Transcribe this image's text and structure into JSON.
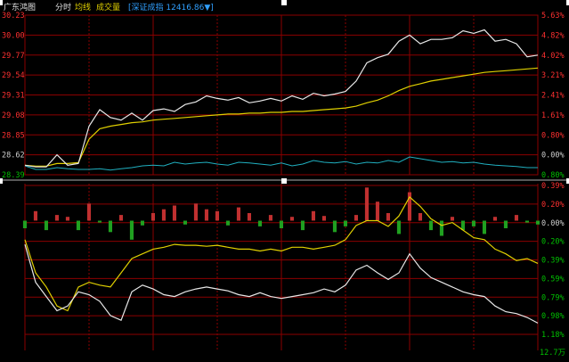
{
  "header": {
    "title": "广东鸿图",
    "tab_intraday": "分时",
    "avg_label": "均线",
    "volume_label": "成交量",
    "index_text": "[深证成指 12416.86▼]"
  },
  "colors": {
    "background": "#000000",
    "grid": "#8b0000",
    "up": "#ff3030",
    "down": "#00c000",
    "flat": "#d0d0d0",
    "price_line": "#e8e8e8",
    "avg_line": "#e0d000",
    "volume_line": "#20b0c0",
    "index_text": "#30a0ff",
    "volume_bar_up": "#c03030",
    "volume_bar_down": "#20a020"
  },
  "chart_data": [
    {
      "type": "line",
      "title": "",
      "y_left_ticks": [
        "30.23",
        "30.00",
        "29.77",
        "29.54",
        "29.31",
        "29.08",
        "28.85",
        "28.62",
        "28.39"
      ],
      "y_right_ticks": [
        "5.63%",
        "4.82%",
        "4.02%",
        "3.21%",
        "2.41%",
        "1.61%",
        "0.80%",
        "0.00%",
        "0.80%"
      ],
      "ylim": [
        28.39,
        30.23
      ],
      "previous_close": 28.62,
      "x": [
        0,
        5,
        10,
        15,
        20,
        25,
        30,
        35,
        40,
        45,
        50,
        55,
        60,
        65,
        70,
        75,
        80,
        85,
        90,
        95,
        100,
        105,
        110,
        115,
        120,
        125,
        130,
        135,
        140,
        145,
        150,
        155,
        160,
        165,
        170,
        175,
        180,
        185,
        190,
        195,
        200,
        205,
        210,
        215,
        220,
        225,
        230,
        235,
        240
      ],
      "series": [
        {
          "role": "price",
          "values": [
            28.5,
            28.48,
            28.48,
            28.62,
            28.5,
            28.52,
            28.95,
            29.14,
            29.05,
            29.02,
            29.1,
            29.02,
            29.13,
            29.15,
            29.12,
            29.2,
            29.23,
            29.3,
            29.27,
            29.25,
            29.28,
            29.22,
            29.24,
            29.27,
            29.24,
            29.3,
            29.26,
            29.33,
            29.3,
            29.32,
            29.35,
            29.47,
            29.68,
            29.74,
            29.78,
            29.93,
            30.0,
            29.9,
            29.95,
            29.95,
            29.97,
            30.05,
            30.02,
            30.06,
            29.93,
            29.95,
            29.9,
            29.75,
            29.77
          ]
        },
        {
          "role": "average",
          "values": [
            28.5,
            28.49,
            28.49,
            28.52,
            28.52,
            28.53,
            28.8,
            28.92,
            28.95,
            28.97,
            28.99,
            29.0,
            29.02,
            29.03,
            29.04,
            29.05,
            29.06,
            29.07,
            29.08,
            29.09,
            29.09,
            29.1,
            29.1,
            29.11,
            29.11,
            29.12,
            29.12,
            29.13,
            29.14,
            29.15,
            29.16,
            29.18,
            29.22,
            29.25,
            29.3,
            29.36,
            29.41,
            29.44,
            29.47,
            29.49,
            29.51,
            29.53,
            29.55,
            29.57,
            29.58,
            29.59,
            29.6,
            29.61,
            29.62
          ]
        },
        {
          "role": "volume",
          "values": [
            0.2,
            0.1,
            0.1,
            0.15,
            0.12,
            0.1,
            0.1,
            0.12,
            0.08,
            0.12,
            0.15,
            0.2,
            0.22,
            0.2,
            0.3,
            0.25,
            0.28,
            0.3,
            0.25,
            0.22,
            0.3,
            0.28,
            0.25,
            0.22,
            0.28,
            0.2,
            0.25,
            0.35,
            0.3,
            0.28,
            0.32,
            0.25,
            0.3,
            0.28,
            0.35,
            0.3,
            0.45,
            0.4,
            0.35,
            0.3,
            0.32,
            0.28,
            0.3,
            0.25,
            0.22,
            0.2,
            0.18,
            0.15,
            0.15
          ]
        }
      ]
    },
    {
      "type": "bar",
      "title": "",
      "y_right_ticks": [
        "0.39%",
        "0.20%",
        "0.00%",
        "0.20%",
        "0.39%",
        "0.59%",
        "0.79%",
        "0.98%",
        "1.18%"
      ],
      "bottom_label": "12.7万",
      "ylim": [
        -1.18,
        0.39
      ],
      "x": [
        0,
        5,
        10,
        15,
        20,
        25,
        30,
        35,
        40,
        45,
        50,
        55,
        60,
        65,
        70,
        75,
        80,
        85,
        90,
        95,
        100,
        105,
        110,
        115,
        120,
        125,
        130,
        135,
        140,
        145,
        150,
        155,
        160,
        165,
        170,
        175,
        180,
        185,
        190,
        195,
        200,
        205,
        210,
        215,
        220,
        225,
        230,
        235,
        240
      ],
      "bars": [
        -0.08,
        0.1,
        -0.1,
        0.06,
        0.04,
        -0.1,
        0.18,
        -0.02,
        -0.12,
        0.06,
        -0.2,
        -0.05,
        0.08,
        0.12,
        0.16,
        -0.04,
        0.18,
        0.12,
        0.1,
        -0.05,
        0.14,
        0.08,
        -0.06,
        0.06,
        -0.08,
        0.04,
        -0.1,
        0.1,
        0.05,
        -0.12,
        -0.06,
        0.06,
        0.35,
        0.2,
        0.08,
        -0.14,
        0.3,
        0.08,
        -0.1,
        -0.16,
        0.04,
        -0.1,
        -0.06,
        -0.14,
        0.04,
        -0.08,
        0.06,
        -0.02,
        -0.04
      ],
      "series": [
        {
          "role": "yellow-line",
          "values": [
            -0.2,
            -0.55,
            -0.7,
            -0.9,
            -0.95,
            -0.7,
            -0.65,
            -0.68,
            -0.7,
            -0.55,
            -0.4,
            -0.35,
            -0.3,
            -0.28,
            -0.25,
            -0.26,
            -0.26,
            -0.27,
            -0.26,
            -0.28,
            -0.3,
            -0.3,
            -0.32,
            -0.3,
            -0.32,
            -0.28,
            -0.28,
            -0.3,
            -0.28,
            -0.26,
            -0.2,
            -0.05,
            0.0,
            0.0,
            -0.06,
            0.05,
            0.25,
            0.15,
            0.02,
            -0.05,
            -0.02,
            -0.1,
            -0.18,
            -0.2,
            -0.3,
            -0.35,
            -0.42,
            -0.4,
            -0.45
          ]
        },
        {
          "role": "white-line",
          "values": [
            -0.25,
            -0.65,
            -0.8,
            -0.95,
            -0.9,
            -0.75,
            -0.78,
            -0.85,
            -1.0,
            -1.05,
            -0.75,
            -0.68,
            -0.72,
            -0.78,
            -0.8,
            -0.75,
            -0.72,
            -0.7,
            -0.72,
            -0.74,
            -0.78,
            -0.8,
            -0.76,
            -0.8,
            -0.82,
            -0.8,
            -0.78,
            -0.76,
            -0.72,
            -0.75,
            -0.68,
            -0.52,
            -0.47,
            -0.55,
            -0.62,
            -0.55,
            -0.35,
            -0.5,
            -0.6,
            -0.65,
            -0.7,
            -0.75,
            -0.78,
            -0.8,
            -0.9,
            -0.96,
            -0.98,
            -1.02,
            -1.08
          ]
        }
      ]
    }
  ]
}
